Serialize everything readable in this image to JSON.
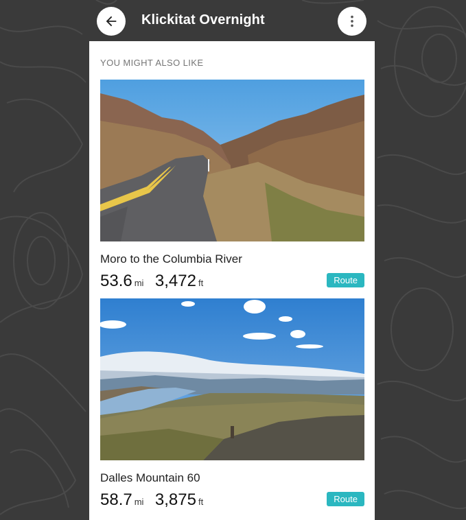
{
  "header": {
    "title": "Klickitat Overnight",
    "back_icon": "arrow-left-icon",
    "more_icon": "more-vertical-icon"
  },
  "section": {
    "label": "YOU MIGHT ALSO LIKE"
  },
  "cards": [
    {
      "name": "Moro to the Columbia River",
      "distance": "53.6",
      "distance_unit": "mi",
      "elevation": "3,472",
      "elevation_unit": "ft",
      "badge": "Route"
    },
    {
      "name": "Dalles Mountain 60",
      "distance": "58.7",
      "distance_unit": "mi",
      "elevation": "3,875",
      "elevation_unit": "ft",
      "badge": "Route"
    }
  ],
  "colors": {
    "background": "#3a3a3a",
    "accent": "#2bb7c0",
    "panel": "#ffffff"
  }
}
